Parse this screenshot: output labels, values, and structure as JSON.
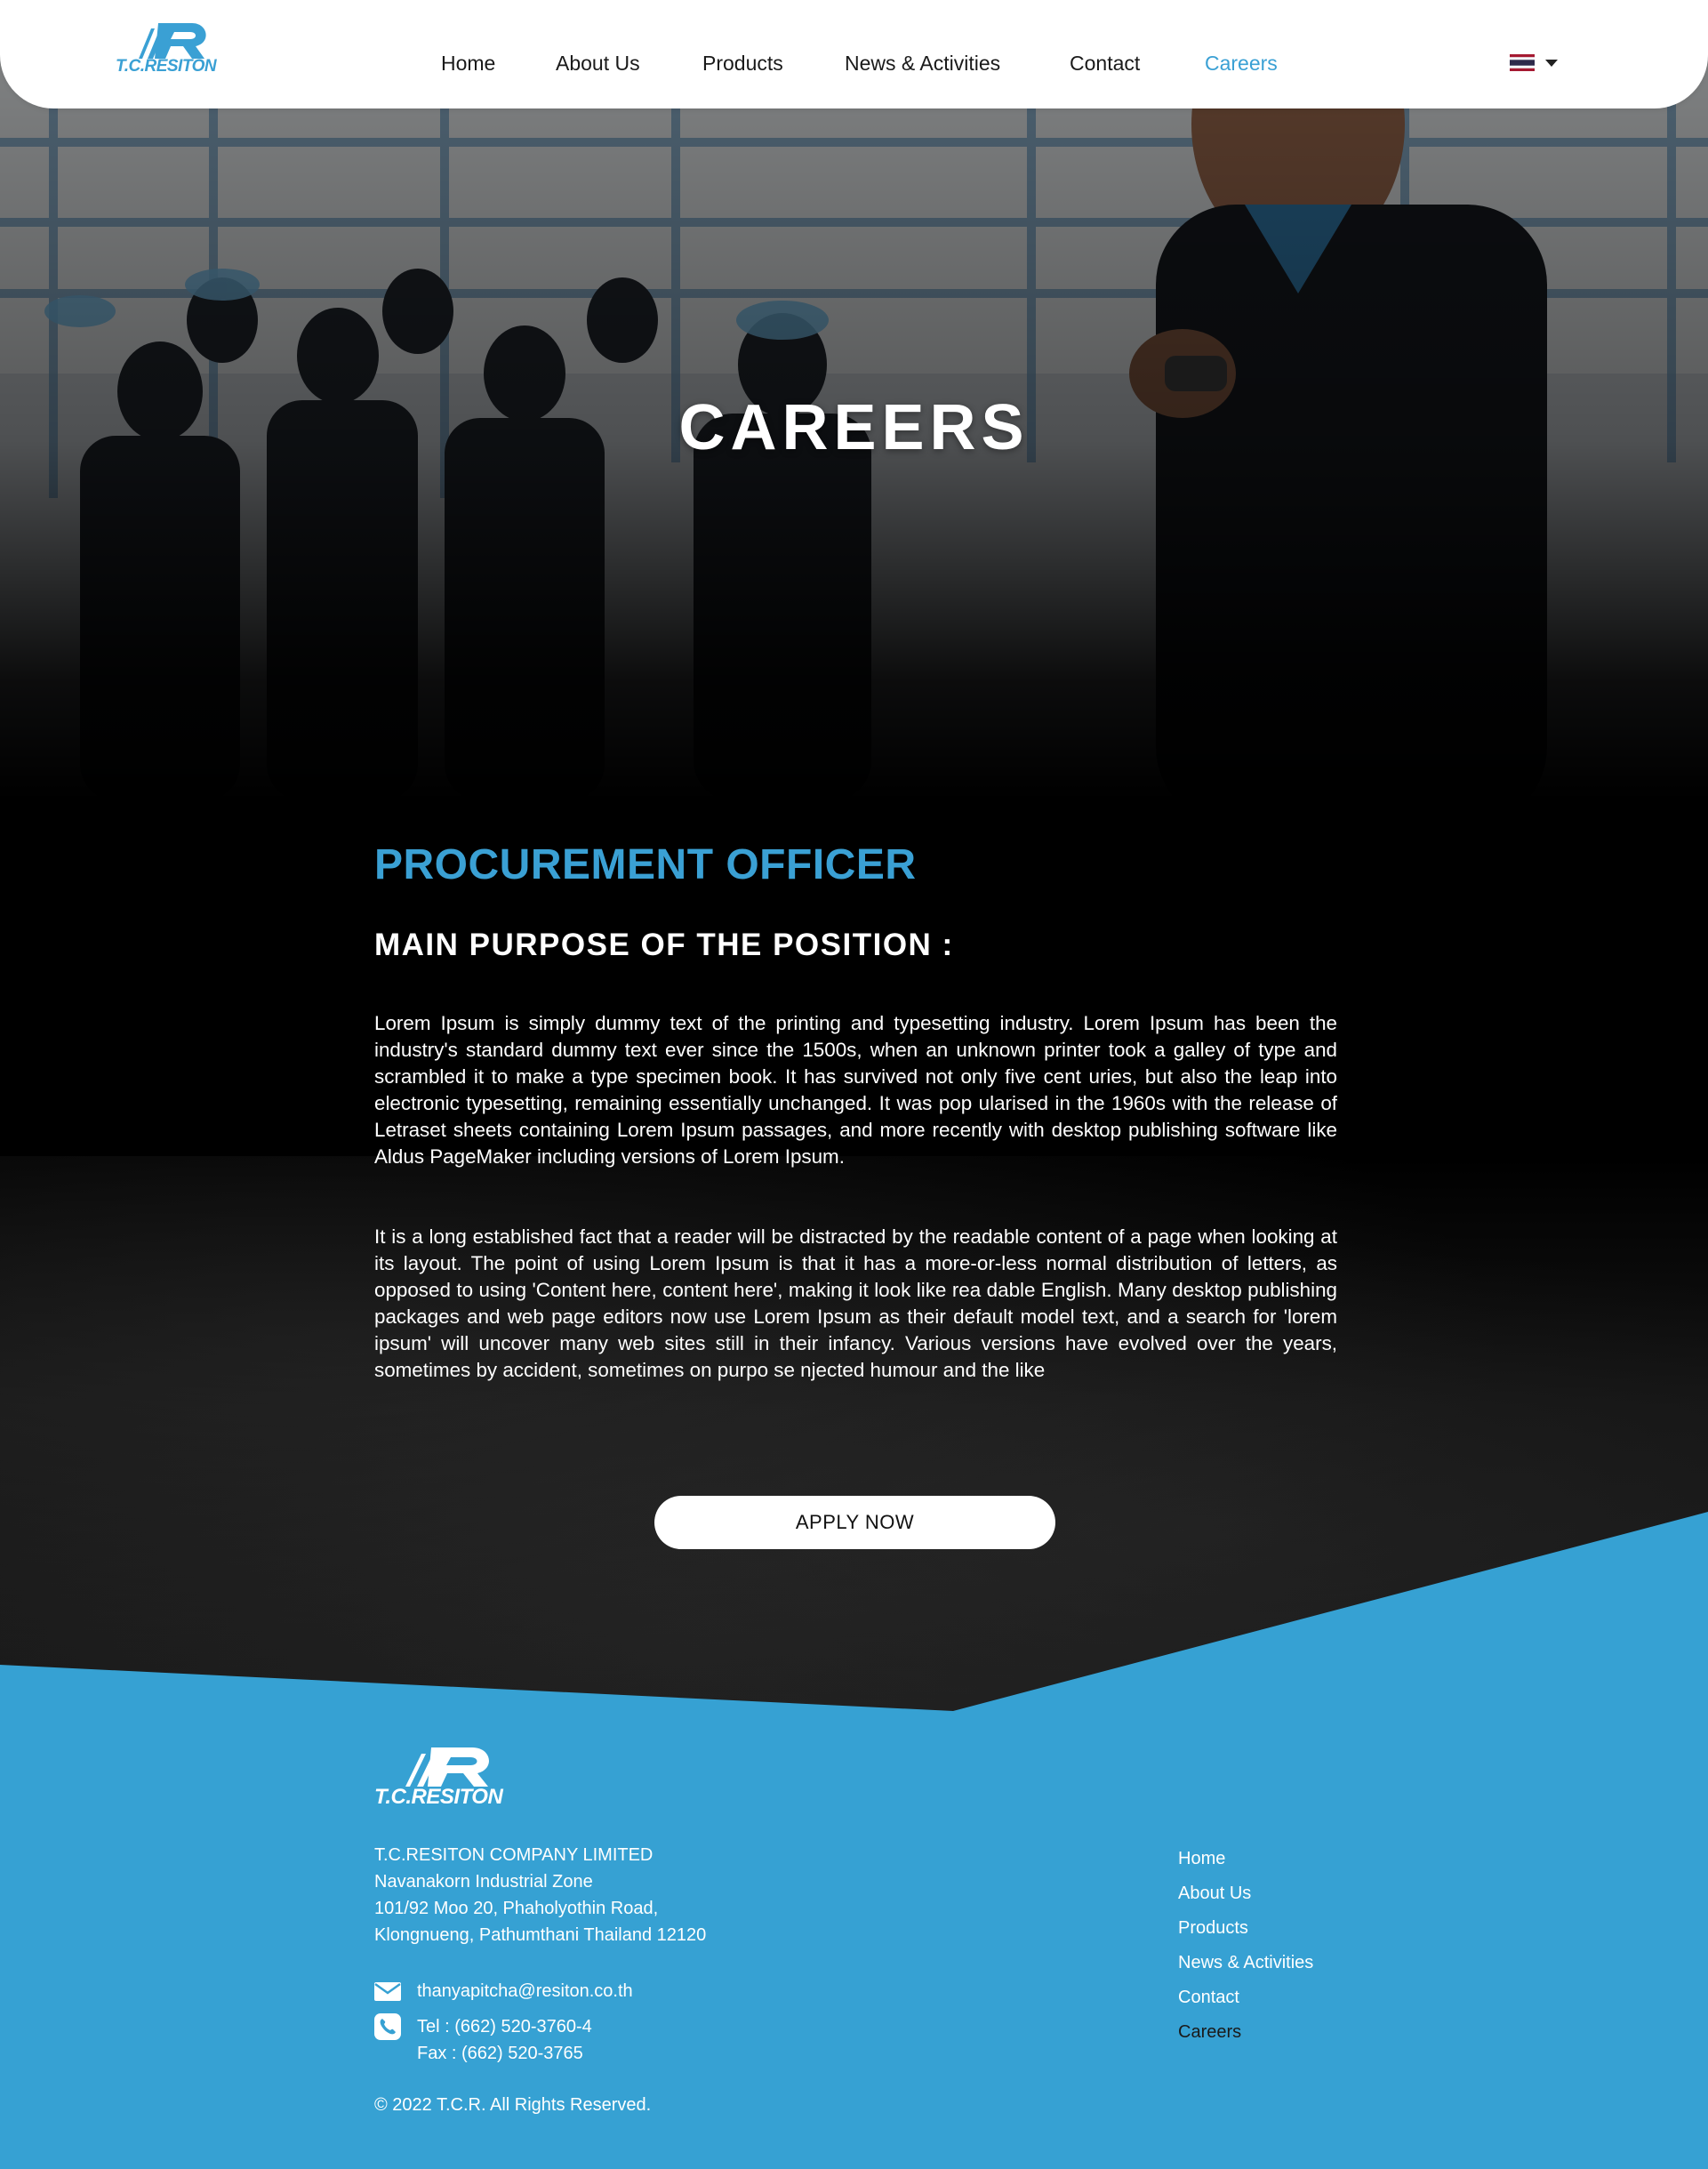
{
  "header": {
    "logo_text": "T.C.RESITON",
    "nav": [
      {
        "label": "Home"
      },
      {
        "label": "About Us"
      },
      {
        "label": "Products"
      },
      {
        "label": "News & Activities"
      },
      {
        "label": "Contact"
      },
      {
        "label": "Careers",
        "active": true
      }
    ],
    "language_flag": "thai-flag-icon"
  },
  "hero": {
    "title": "CAREERS"
  },
  "job": {
    "title": "PROCUREMENT OFFICER",
    "purpose_heading": "MAIN PURPOSE OF THE POSITION :",
    "paragraph_1": "Lorem Ipsum is simply dummy text of the printing and typesetting industry. Lorem Ipsum has been the industry's standard dummy text ever since the 1500s, when an unknown printer took a galley of type and scrambled it to make a type specimen book. It has survived not only five cent uries, but also the leap into electronic typesetting, remaining essentially unchanged. It was pop ularised in the 1960s with the release of Letraset sheets containing Lorem Ipsum passages, and more recently with desktop publishing software like Aldus PageMaker including versions of Lorem Ipsum.",
    "paragraph_2": "It is a long established fact that a reader will be distracted by the readable content of a page when looking at its layout. The point of using Lorem Ipsum is that it has a more-or-less normal distribution of letters, as opposed to using 'Content here, content here', making it look like rea dable English. Many desktop publishing packages and web page editors now use Lorem Ipsum as their default model text, and a search for 'lorem ipsum' will uncover many web sites still in their infancy. Various versions have evolved over the years, sometimes by accident, sometimes on purpo se njected humour and the like",
    "apply_label": "APPLY NOW"
  },
  "footer": {
    "logo_text": "T.C.RESITON",
    "company_lines": [
      "T.C.RESITON COMPANY LIMITED",
      "Navanakorn Industrial Zone",
      "101/92 Moo 20, Phaholyothin Road,",
      "Klongnueng, Pathumthani Thailand 12120"
    ],
    "email": "thanyapitcha@resiton.co.th",
    "tel": "Tel  : (662) 520-3760-4",
    "fax": "Fax : (662) 520-3765",
    "copyright": "© 2022 T.C.R. All Rights Reserved.",
    "nav": [
      {
        "label": "Home"
      },
      {
        "label": "About Us"
      },
      {
        "label": "Products"
      },
      {
        "label": "News & Activities"
      },
      {
        "label": "Contact"
      },
      {
        "label": "Careers",
        "active": true
      }
    ]
  },
  "colors": {
    "accent": "#3aa0d4",
    "footer_bg": "#36a1d3",
    "dark_bg": "#000000"
  }
}
